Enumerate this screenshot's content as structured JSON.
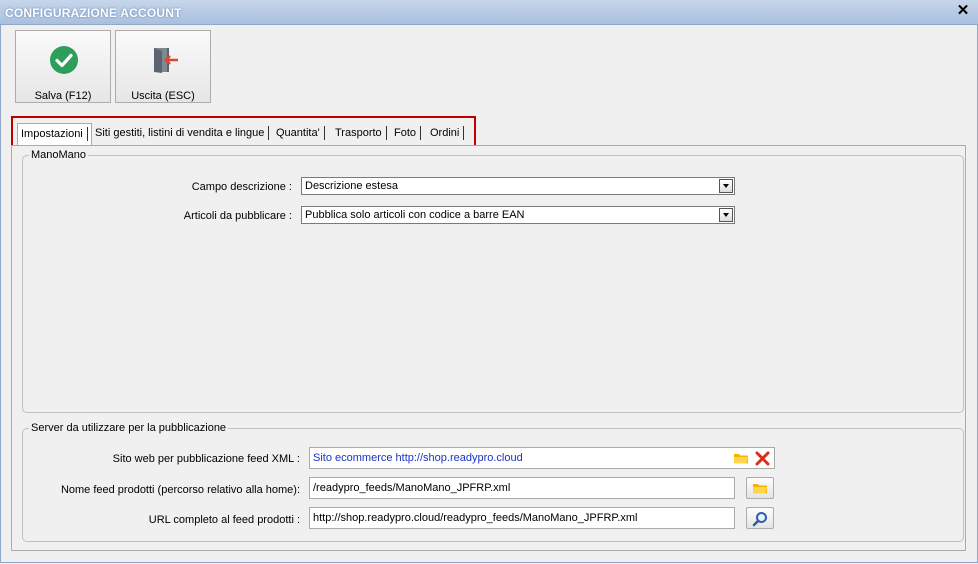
{
  "window": {
    "title": "CONFIGURAZIONE ACCOUNT",
    "close_glyph": "✕"
  },
  "toolbar": {
    "save_label": "Salva (F12)",
    "exit_label": "Uscita (ESC)",
    "save_icon": "check-circle-icon",
    "exit_icon": "exit-door-icon"
  },
  "tabs": [
    {
      "label": "Impostazioni",
      "active": true
    },
    {
      "label": "Siti gestiti, listini di vendita e lingue"
    },
    {
      "label": "Quantita'"
    },
    {
      "label": "Trasporto"
    },
    {
      "label": "Foto"
    },
    {
      "label": "Ordini"
    }
  ],
  "manomano": {
    "legend": "ManoMano",
    "campo_label": "Campo descrizione :",
    "campo_value": "Descrizione estesa",
    "articoli_label": "Articoli da pubblicare :",
    "articoli_value": "Pubblica solo articoli con codice a barre EAN"
  },
  "server": {
    "legend": "Server da utilizzare per la pubblicazione",
    "sito_label": "Sito web per pubblicazione feed XML :",
    "sito_value": "Sito ecommerce http://shop.readypro.cloud",
    "nome_label": "Nome feed prodotti (percorso relativo alla home):",
    "nome_value": "/readypro_feeds/ManoMano_JPFRP.xml",
    "url_label": "URL completo al feed prodotti :",
    "url_value": "http://shop.readypro.cloud/readypro_feeds/ManoMano_JPFRP.xml"
  },
  "colors": {
    "accent_red": "#c00000",
    "link_blue": "#1a32c8",
    "check_green": "#2e9e5b"
  }
}
